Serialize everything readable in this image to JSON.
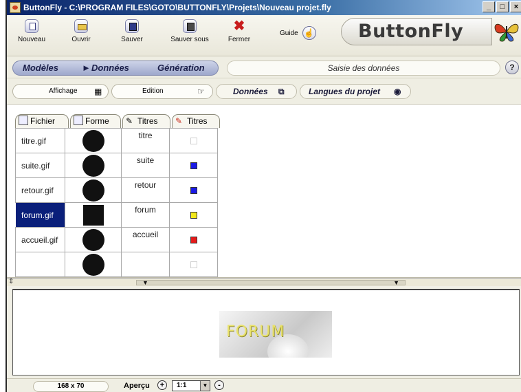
{
  "window": {
    "title": "ButtonFly - C:\\PROGRAM FILES\\GOTO\\BUTTONFLY\\Projets\\Nouveau projet.fly",
    "controls": {
      "minimize": "_",
      "maximize": "□",
      "close": "×"
    }
  },
  "toolbar": {
    "nouveau": "Nouveau",
    "ouvrir": "Ouvrir",
    "sauver": "Sauver",
    "sauver_sous": "Sauver sous",
    "fermer": "Fermer",
    "guide": "Guide",
    "brand": "ButtonFly"
  },
  "nav": {
    "modeles": "Modèles",
    "donnees": "Données",
    "generation": "Génération",
    "status": "Saisie des données",
    "help": "?"
  },
  "subbar": {
    "affichage": "Affichage",
    "edition": "Edition",
    "donnees_tab": "Données",
    "langues_tab": "Langues du projet"
  },
  "grid": {
    "tabs": [
      "Fichier",
      "Forme",
      "Titres",
      "Titres"
    ],
    "rows": [
      {
        "file": "titre.gif",
        "shape": "circle",
        "title": "titre",
        "color": "empty"
      },
      {
        "file": "suite.gif",
        "shape": "circle",
        "title": "suite",
        "color": "#1a1ae6"
      },
      {
        "file": "retour.gif",
        "shape": "circle",
        "title": "retour",
        "color": "#1a1ae6"
      },
      {
        "file": "forum.gif",
        "shape": "square",
        "title": "forum",
        "color": "#f2e81a",
        "selected": true
      },
      {
        "file": "accueil.gif",
        "shape": "circle",
        "title": "accueil",
        "color": "#e61a1a"
      },
      {
        "file": "",
        "shape": "circle",
        "title": "",
        "color": "empty"
      }
    ]
  },
  "preview": {
    "image_text": "FORUM"
  },
  "statusbar": {
    "size": "168 x 70",
    "apercu": "Aperçu",
    "plus": "+",
    "zoom": "1:1",
    "minus": "-"
  },
  "colors": {
    "titlebar": "#0a246a",
    "selected_row": "#0a1f7a",
    "nav_pill": "#9ea8cc"
  }
}
